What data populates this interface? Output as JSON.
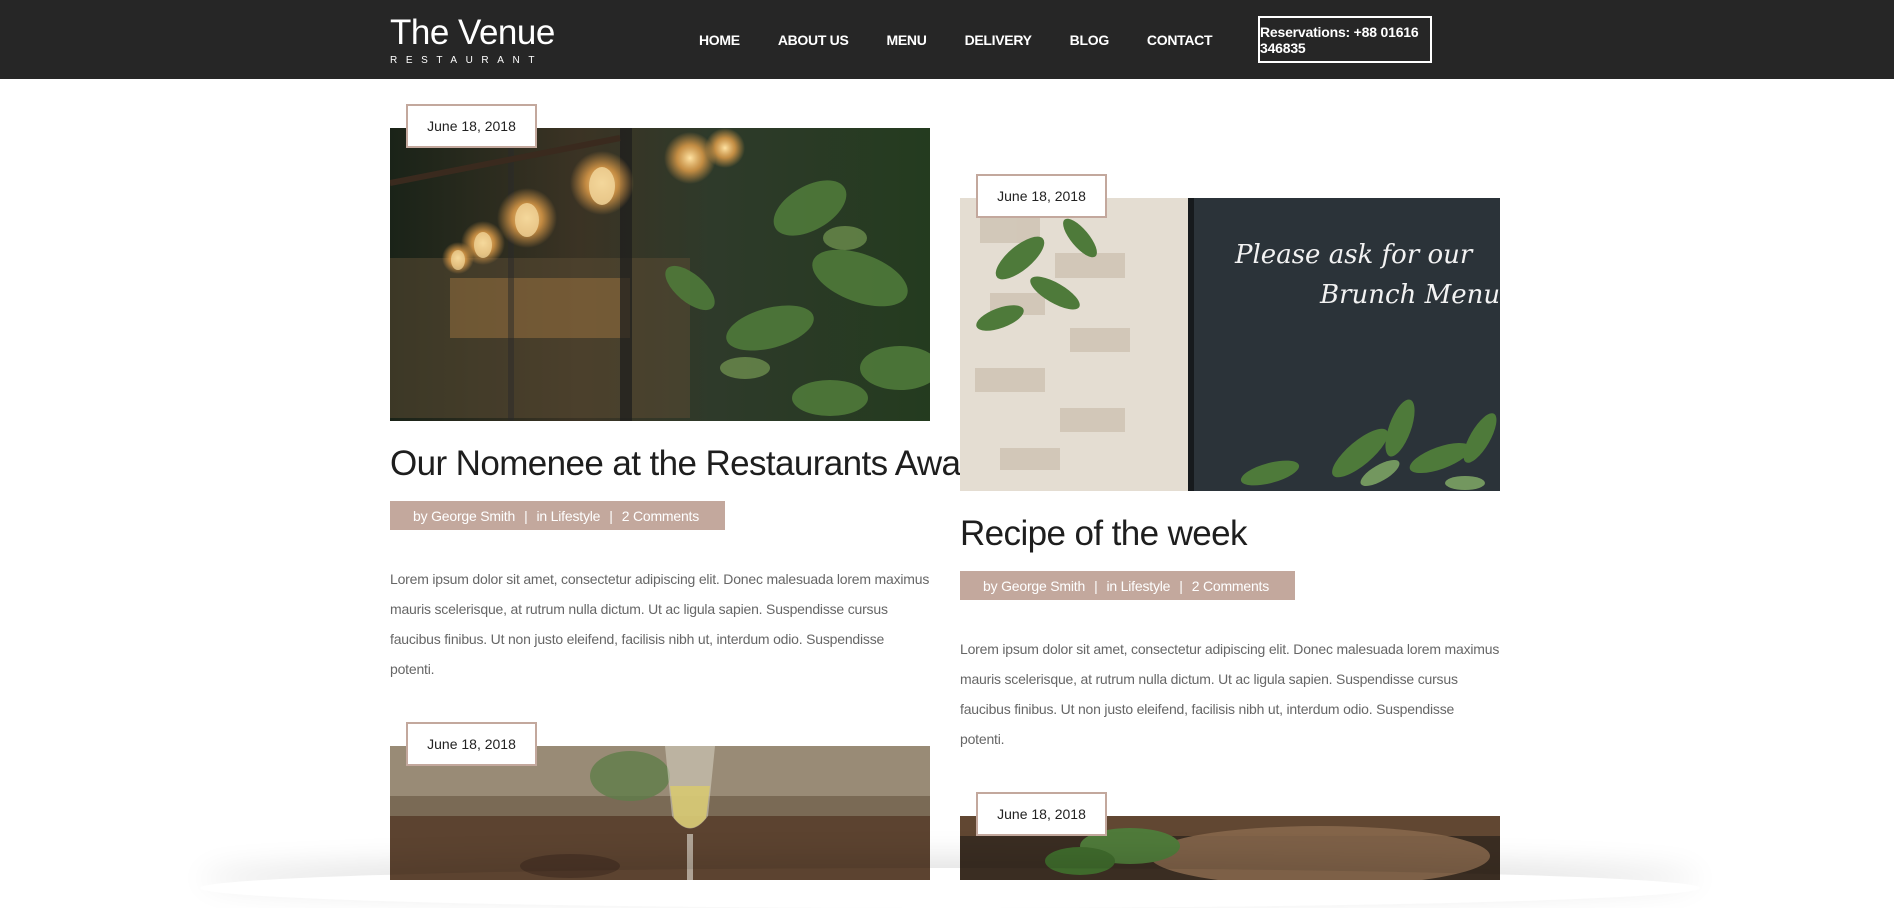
{
  "header": {
    "logo_title": "The Venue",
    "logo_subtitle": "RESTAURANT",
    "nav": [
      "HOME",
      "ABOUT US",
      "MENU",
      "DELIVERY",
      "BLOG",
      "CONTACT"
    ],
    "reservation_label": "Reservations: +88 01616 346835"
  },
  "colors": {
    "header_bg": "#262626",
    "accent": "#c3a89d"
  },
  "posts": [
    {
      "date": "June 18, 2018",
      "title": "Our Nomenee at the Restaurants Awards",
      "author": "by George Smith",
      "category": "in Lifestyle",
      "comments": "2 Comments",
      "excerpt": "Lorem ipsum dolor sit amet, consectetur adipiscing elit. Donec malesuada lorem maximus mauris scelerisque, at rutrum nulla dictum. Ut ac ligula sapien. Suspendisse cursus faucibus finibus. Ut non justo eleifend, facilisis nibh ut, interdum odio. Suspendisse potenti.",
      "image": "restaurant-interior-bulbs-image"
    },
    {
      "date": "June 18, 2018",
      "title": "Recipe of the week",
      "author": "by George Smith",
      "category": "in Lifestyle",
      "comments": "2 Comments",
      "excerpt": "Lorem ipsum dolor sit amet, consectetur adipiscing elit. Donec malesuada lorem maximus mauris scelerisque, at rutrum nulla dictum. Ut ac ligula sapien. Suspendisse cursus faucibus finibus. Ut non justo eleifend, facilisis nibh ut, interdum odio. Suspendisse potenti.",
      "chalkboard_text": "Please ask for our Brunch Menu!",
      "image": "chalkboard-brick-wall-image"
    },
    {
      "date": "June 18, 2018",
      "image": "wine-glass-table-image"
    },
    {
      "date": "June 18, 2018",
      "image": "plated-food-image"
    }
  ]
}
